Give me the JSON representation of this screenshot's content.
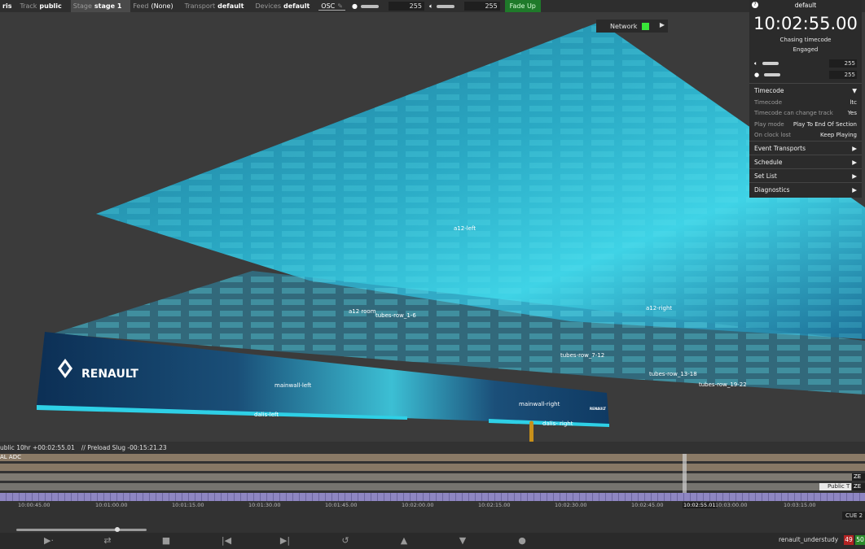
{
  "toolbar": {
    "project_fragment": "ris",
    "track_label": "Track",
    "track_value": "public",
    "stage_label": "Stage",
    "stage_value": "stage 1",
    "feed_label": "Feed",
    "feed_value": "(None)",
    "transport_label": "Transport",
    "transport_value": "default",
    "devices_label": "Devices",
    "devices_value": "default",
    "osc_label": "OSC",
    "brightness_value": "255",
    "volume_value": "255",
    "fade_up_label": "Fade Up"
  },
  "network": {
    "label": "Network",
    "status_color": "#39e639"
  },
  "panel": {
    "title": "default",
    "clock": "10:02:55.00",
    "status_line1": "Chasing timecode",
    "status_line2": "Engaged",
    "volume_value": "255",
    "brightness_value": "255",
    "timecode_section": "Timecode",
    "rows": [
      {
        "label": "Timecode",
        "value": "ltc"
      },
      {
        "label": "Timecode can change track",
        "value": "Yes"
      },
      {
        "label": "Play mode",
        "value": "Play To End Of Section"
      },
      {
        "label": "On clock lost",
        "value": "Keep Playing"
      }
    ],
    "sections": [
      "Event Transports",
      "Schedule",
      "Set List",
      "Diagnostics"
    ]
  },
  "scene": {
    "labels": {
      "a12_left": "a12-left",
      "a12_room": "a12 room",
      "tubes_row_1_6": "tubes-row_1-6",
      "a12_right": "a12-right",
      "tubes_row_7_12": "tubes-row_7-12",
      "tubes_row_13_18": "tubes-row_13-18",
      "tubes_row_19_22": "tubes-row_19-22",
      "mainwall_left": "mainwall-left",
      "mainwall_right": "mainwall-right",
      "dalis_left": "dalis-left",
      "dalis_right": "dalis- right"
    },
    "brand": "RENAULT",
    "brand_small": "RENAULT"
  },
  "timeline": {
    "status_left": "ublic 10hr +00:02:55.01",
    "status_preload": "// Preload Slug -00:15:21.23",
    "track_adc": "AL ADC",
    "right_tag_1": "ZE",
    "right_tag_2": "Public T",
    "right_tag_3": "ZE",
    "ticks": [
      "10:00:45.00",
      "10:01:00.00",
      "10:01:15.00",
      "10:01:30.00",
      "10:01:45.00",
      "10:02:00.00",
      "10:02:15.00",
      "10:02:30.00",
      "10:02:45.00",
      "10:02:55.01",
      "10:03:00.00",
      "10:03:15.00"
    ],
    "cue_label": "CUE 2"
  },
  "transport": {
    "show_name": "renault_understudy",
    "badge_red": "49",
    "badge_green": "50"
  }
}
